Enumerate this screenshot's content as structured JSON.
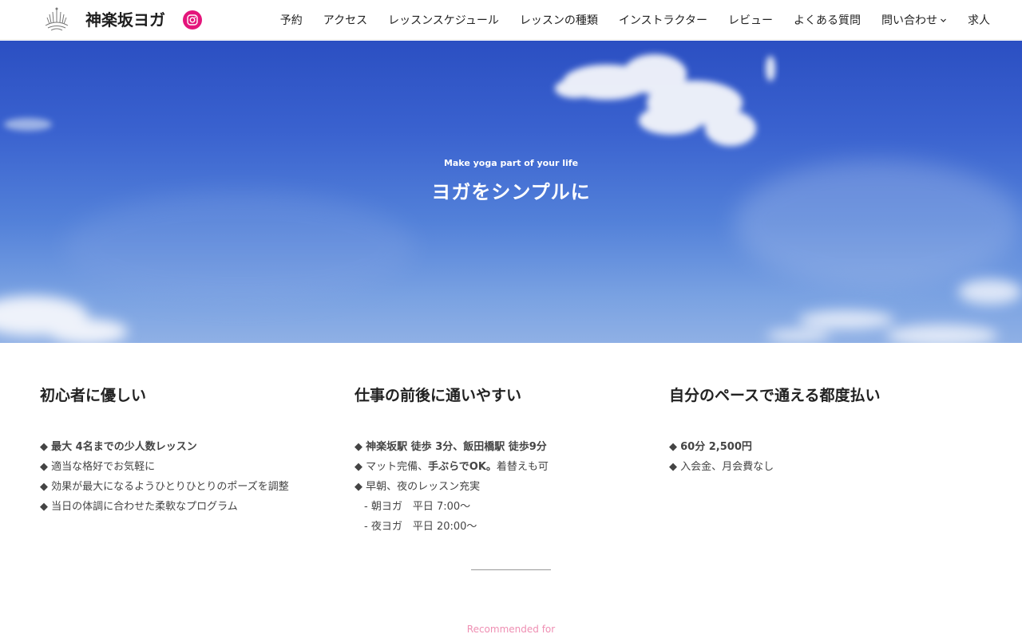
{
  "header": {
    "site_title": "神楽坂ヨガ",
    "logo_icon": "lotus-logo-icon",
    "instagram_icon": "instagram-icon",
    "instagram_color": "#e4157b"
  },
  "nav": {
    "items": [
      {
        "label": "予約"
      },
      {
        "label": "アクセス"
      },
      {
        "label": "レッスンスケジュール"
      },
      {
        "label": "レッスンの種類"
      },
      {
        "label": "インストラクター"
      },
      {
        "label": "レビュー"
      },
      {
        "label": "よくある質問"
      },
      {
        "label": "問い合わせ",
        "has_dropdown": true
      },
      {
        "label": "求人"
      }
    ]
  },
  "hero": {
    "subtitle": "Make yoga part of your life",
    "title": "ヨガをシンプルに"
  },
  "features": [
    {
      "heading": "初心者に優しい",
      "items": [
        {
          "marker": "◆ ",
          "bold": "最大 4名までの少人数レッスン",
          "text": ""
        },
        {
          "marker": "◆ ",
          "bold": "",
          "text": "適当な格好でお気軽に"
        },
        {
          "marker": "◆ ",
          "bold": "",
          "text": "効果が最大になるようひとりひとりのポーズを調整"
        },
        {
          "marker": "◆ ",
          "bold": "",
          "text": "当日の体調に合わせた柔軟なプログラム"
        }
      ]
    },
    {
      "heading": "仕事の前後に通いやすい",
      "items": [
        {
          "marker": "◆ ",
          "bold": "神楽坂駅 徒歩 3分、飯田橋駅 徒歩9分",
          "text": ""
        },
        {
          "marker": "◆ ",
          "bold": "",
          "text": "マット完備、",
          "bold2": "手ぶらでOK。",
          "text2": "着替えも可"
        },
        {
          "marker": "◆ ",
          "bold": "",
          "text": "早朝、夜のレッスン充実"
        },
        {
          "marker": "",
          "bold": "",
          "text": "- 朝ヨガ　平日 7:00〜",
          "sub": true
        },
        {
          "marker": "",
          "bold": "",
          "text": "- 夜ヨガ　平日 20:00〜",
          "sub": true
        }
      ]
    },
    {
      "heading": "自分のペースで通える都度払い",
      "items": [
        {
          "marker": "◆ ",
          "bold": "60分 2,500円",
          "text": ""
        },
        {
          "marker": "◆ ",
          "bold": "",
          "text": "入会金、月会費なし"
        }
      ]
    }
  ],
  "recommended": {
    "label": "Recommended for",
    "color": "#ef8fb3"
  }
}
